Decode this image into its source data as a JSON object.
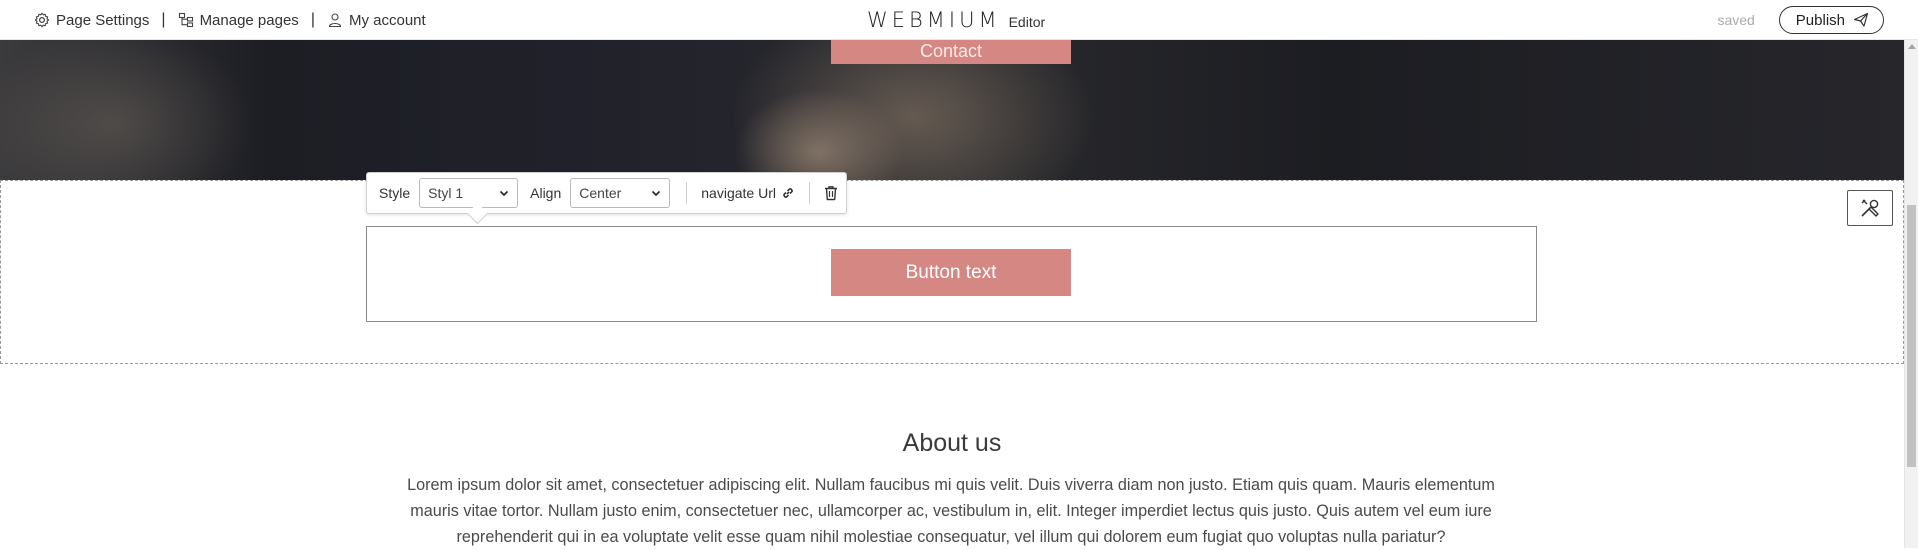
{
  "topbar": {
    "page_settings": "Page Settings",
    "separator": "|",
    "manage_pages": "Manage pages",
    "my_account": "My account",
    "brand": "WEBMIUM",
    "brand_sub": "Editor",
    "status": "saved",
    "publish": "Publish"
  },
  "hero": {
    "contact_button": "Contact"
  },
  "toolbar": {
    "style_label": "Style",
    "style_value": "Styl 1",
    "align_label": "Align",
    "align_value": "Center",
    "navigate_url": "navigate Url"
  },
  "block": {
    "button_text": "Button text"
  },
  "about": {
    "title": "About us",
    "body": "Lorem ipsum dolor sit amet, consectetuer adipiscing elit. Nullam faucibus mi quis velit. Duis viverra diam non justo. Etiam quis quam. Mauris elementum mauris vitae tortor. Nullam justo enim, consectetuer nec, ullamcorper ac, vestibulum in, elit. Integer imperdiet lectus quis justo. Quis autem vel eum iure reprehenderit qui in ea voluptate velit esse quam nihil molestiae consequatur, vel illum qui dolorem eum fugiat quo voluptas nulla pariatur?"
  },
  "colors": {
    "accent": "#d58883",
    "text": "#333333",
    "muted": "#aaaaaa"
  },
  "icons": [
    "gear-icon",
    "sitemap-icon",
    "user-icon",
    "paper-plane-icon",
    "tools-icon",
    "chevron-down-icon",
    "link-icon",
    "trash-icon"
  ]
}
